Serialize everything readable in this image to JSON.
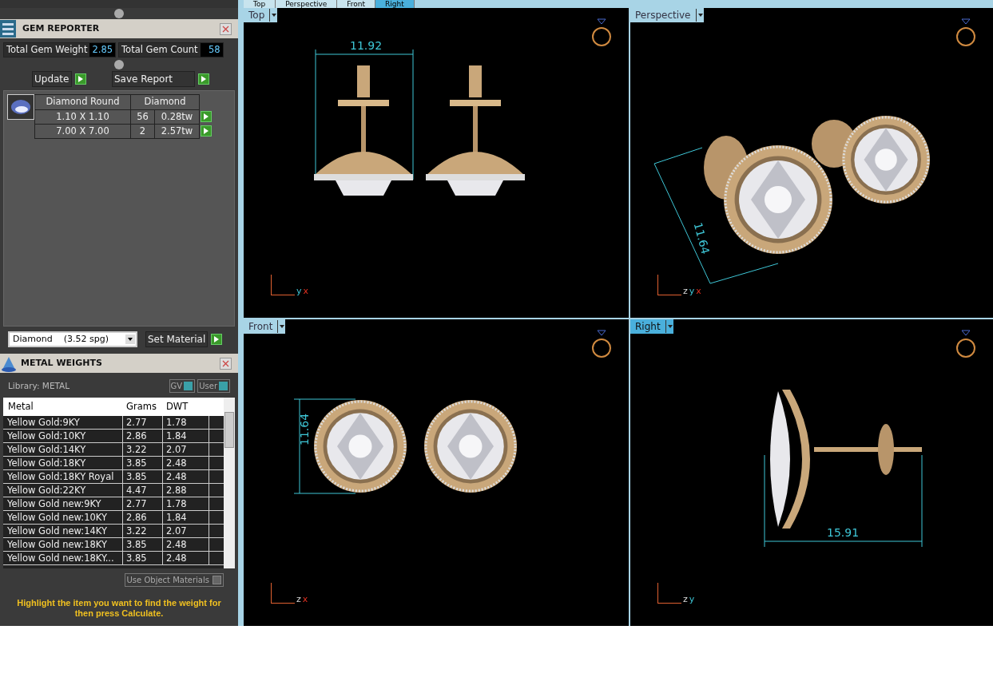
{
  "gem_reporter": {
    "title": "GEM REPORTER",
    "totals": [
      {
        "label": "Total Gem Weight",
        "value": "2.85"
      },
      {
        "label": "Total Gem Count",
        "value": "58"
      }
    ],
    "buttons": [
      "Update",
      "Save Report"
    ],
    "table": {
      "columns": [
        "Diamond Round",
        "Diamond"
      ],
      "rows": [
        {
          "size": "1.10 X 1.10",
          "count": "56",
          "weight": "0.28tw"
        },
        {
          "size": "7.00 X 7.00",
          "count": "2",
          "weight": "2.57tw"
        }
      ]
    },
    "material_select": "Diamond    (3.52 spg)",
    "set_material": "Set Material"
  },
  "metal_weights": {
    "title": "METAL WEIGHTS",
    "library": "Library: METAL",
    "toggles": [
      {
        "label": "GV",
        "on": true
      },
      {
        "label": "User",
        "on": true
      }
    ],
    "columns": [
      "Metal",
      "Grams",
      "DWT"
    ],
    "rows": [
      [
        "Yellow Gold:9KY",
        "2.77",
        "1.78"
      ],
      [
        "Yellow Gold:10KY",
        "2.86",
        "1.84"
      ],
      [
        "Yellow Gold:14KY",
        "3.22",
        "2.07"
      ],
      [
        "Yellow Gold:18KY",
        "3.85",
        "2.48"
      ],
      [
        "Yellow Gold:18KY Royal",
        "3.85",
        "2.48"
      ],
      [
        "Yellow Gold:22KY",
        "4.47",
        "2.88"
      ],
      [
        "Yellow Gold new:9KY",
        "2.77",
        "1.78"
      ],
      [
        "Yellow Gold new:10KY",
        "2.86",
        "1.84"
      ],
      [
        "Yellow Gold new:14KY",
        "3.22",
        "2.07"
      ],
      [
        "Yellow Gold new:18KY",
        "3.85",
        "2.48"
      ],
      [
        "Yellow Gold new:18KY...",
        "3.85",
        "2.48"
      ]
    ],
    "use_object_materials": {
      "label": "Use Object Materials",
      "checked": false
    },
    "hint": "Highlight the item you want to find the weight for then press Calculate."
  },
  "view_tabs": [
    {
      "label": "Top",
      "selected": false
    },
    {
      "label": "Perspective",
      "selected": false
    },
    {
      "label": "Front",
      "selected": false
    },
    {
      "label": "Right",
      "selected": true
    }
  ],
  "viewports": [
    {
      "label": "Top",
      "kind": "top",
      "selected": false,
      "dimension": "11.92",
      "axes": [
        "y",
        "x"
      ]
    },
    {
      "label": "Perspective",
      "kind": "perspective",
      "selected": false,
      "dimension": "11.64",
      "axes": [
        "z",
        "y",
        "x"
      ]
    },
    {
      "label": "Front",
      "kind": "front",
      "selected": false,
      "dimension": "11.64",
      "axes": [
        "z",
        "x"
      ]
    },
    {
      "label": "Right",
      "kind": "right",
      "selected": true,
      "dimension": "15.91",
      "axes": [
        "z",
        "y"
      ]
    }
  ]
}
